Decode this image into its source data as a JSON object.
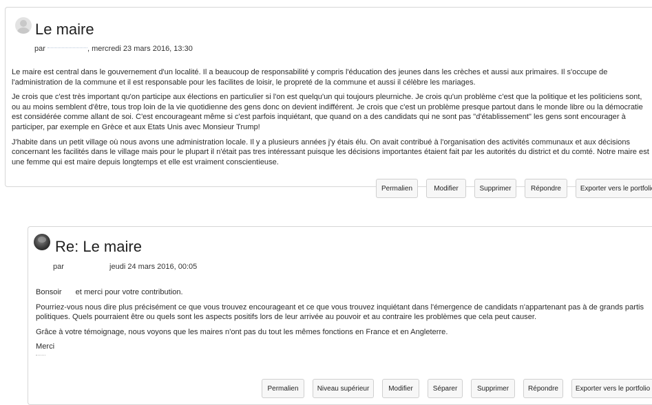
{
  "posts": [
    {
      "title": "Le maire",
      "by": "par",
      "date": ", mercredi 23 mars 2016, 13:30",
      "paragraphs": [
        "Le maire est central dans le gouvernement d'un localité.  Il a beaucoup de responsabilité y compris l'éducation des jeunes dans les crèches et aussi aux primaires.  Il s'occupe de l'administration de la commune et il est responsable pour les facilites de loisir, le propreté de la commune et aussi il célèbre les mariages.",
        "Je crois que c'est très important qu'on participe aux élections  en particulier si l'on est quelqu'un qui toujours pleurniche.  Je crois qu'un problème c'est que la politique et les politiciens sont, ou au moins semblent d'être,  tous trop loin de la vie quotidienne des gens donc on devient indifférent.  Je crois que c'est un problème presque partout dans le monde libre ou la démocratie est considérée comme allant de soi.  C'est encourageant même si c'est parfois inquiétant, que quand on a des candidats qui ne sont pas \"d'établissement\" les gens sont encourager à participer, par exemple en Grèce et aux Etats Unis avec Monsieur Trump!",
        "J'habite dans un petit village où nous avons une administration locale.  Il y a plusieurs années j'y étais élu.  On avait contribué à l'organisation des activités communaux et aux décisions concernant les facilités dans le village mais pour le plupart il n'était pas tres intéressant puisque les décisions importantes étaient fait par les autorités du district et du comté. Notre maire est une femme qui est maire depuis longtemps et elle est vraiment conscientieuse."
      ],
      "buttons": [
        "Permalien",
        "Modifier",
        "Supprimer",
        "Répondre",
        "Exporter vers le portfolio"
      ]
    },
    {
      "title": "Re: Le maire",
      "by": "par",
      "date": "jeudi 24 mars 2016, 00:05",
      "greeting_start": "Bonsoir",
      "greeting_end": "et merci pour votre contribution.",
      "paragraphs": [
        "Pourriez-vous nous dire plus précisément ce que vous trouvez encourageant et ce que vous trouvez inquiétant dans l'émergence de candidats n'appartenant pas à de grands partis politiques. Quels pourraient être ou quels sont les aspects positifs lors de leur arrivée au pouvoir et au contraire les problèmes que cela peut causer.",
        "Grâce à votre témoignage, nous voyons que les maires n'ont pas du tout les mêmes fonctions en France et en Angleterre.",
        "Merci"
      ],
      "buttons": [
        "Permalien",
        "Niveau supérieur",
        "Modifier",
        "Séparer",
        "Supprimer",
        "Répondre",
        "Exporter vers le portfolio"
      ]
    }
  ]
}
